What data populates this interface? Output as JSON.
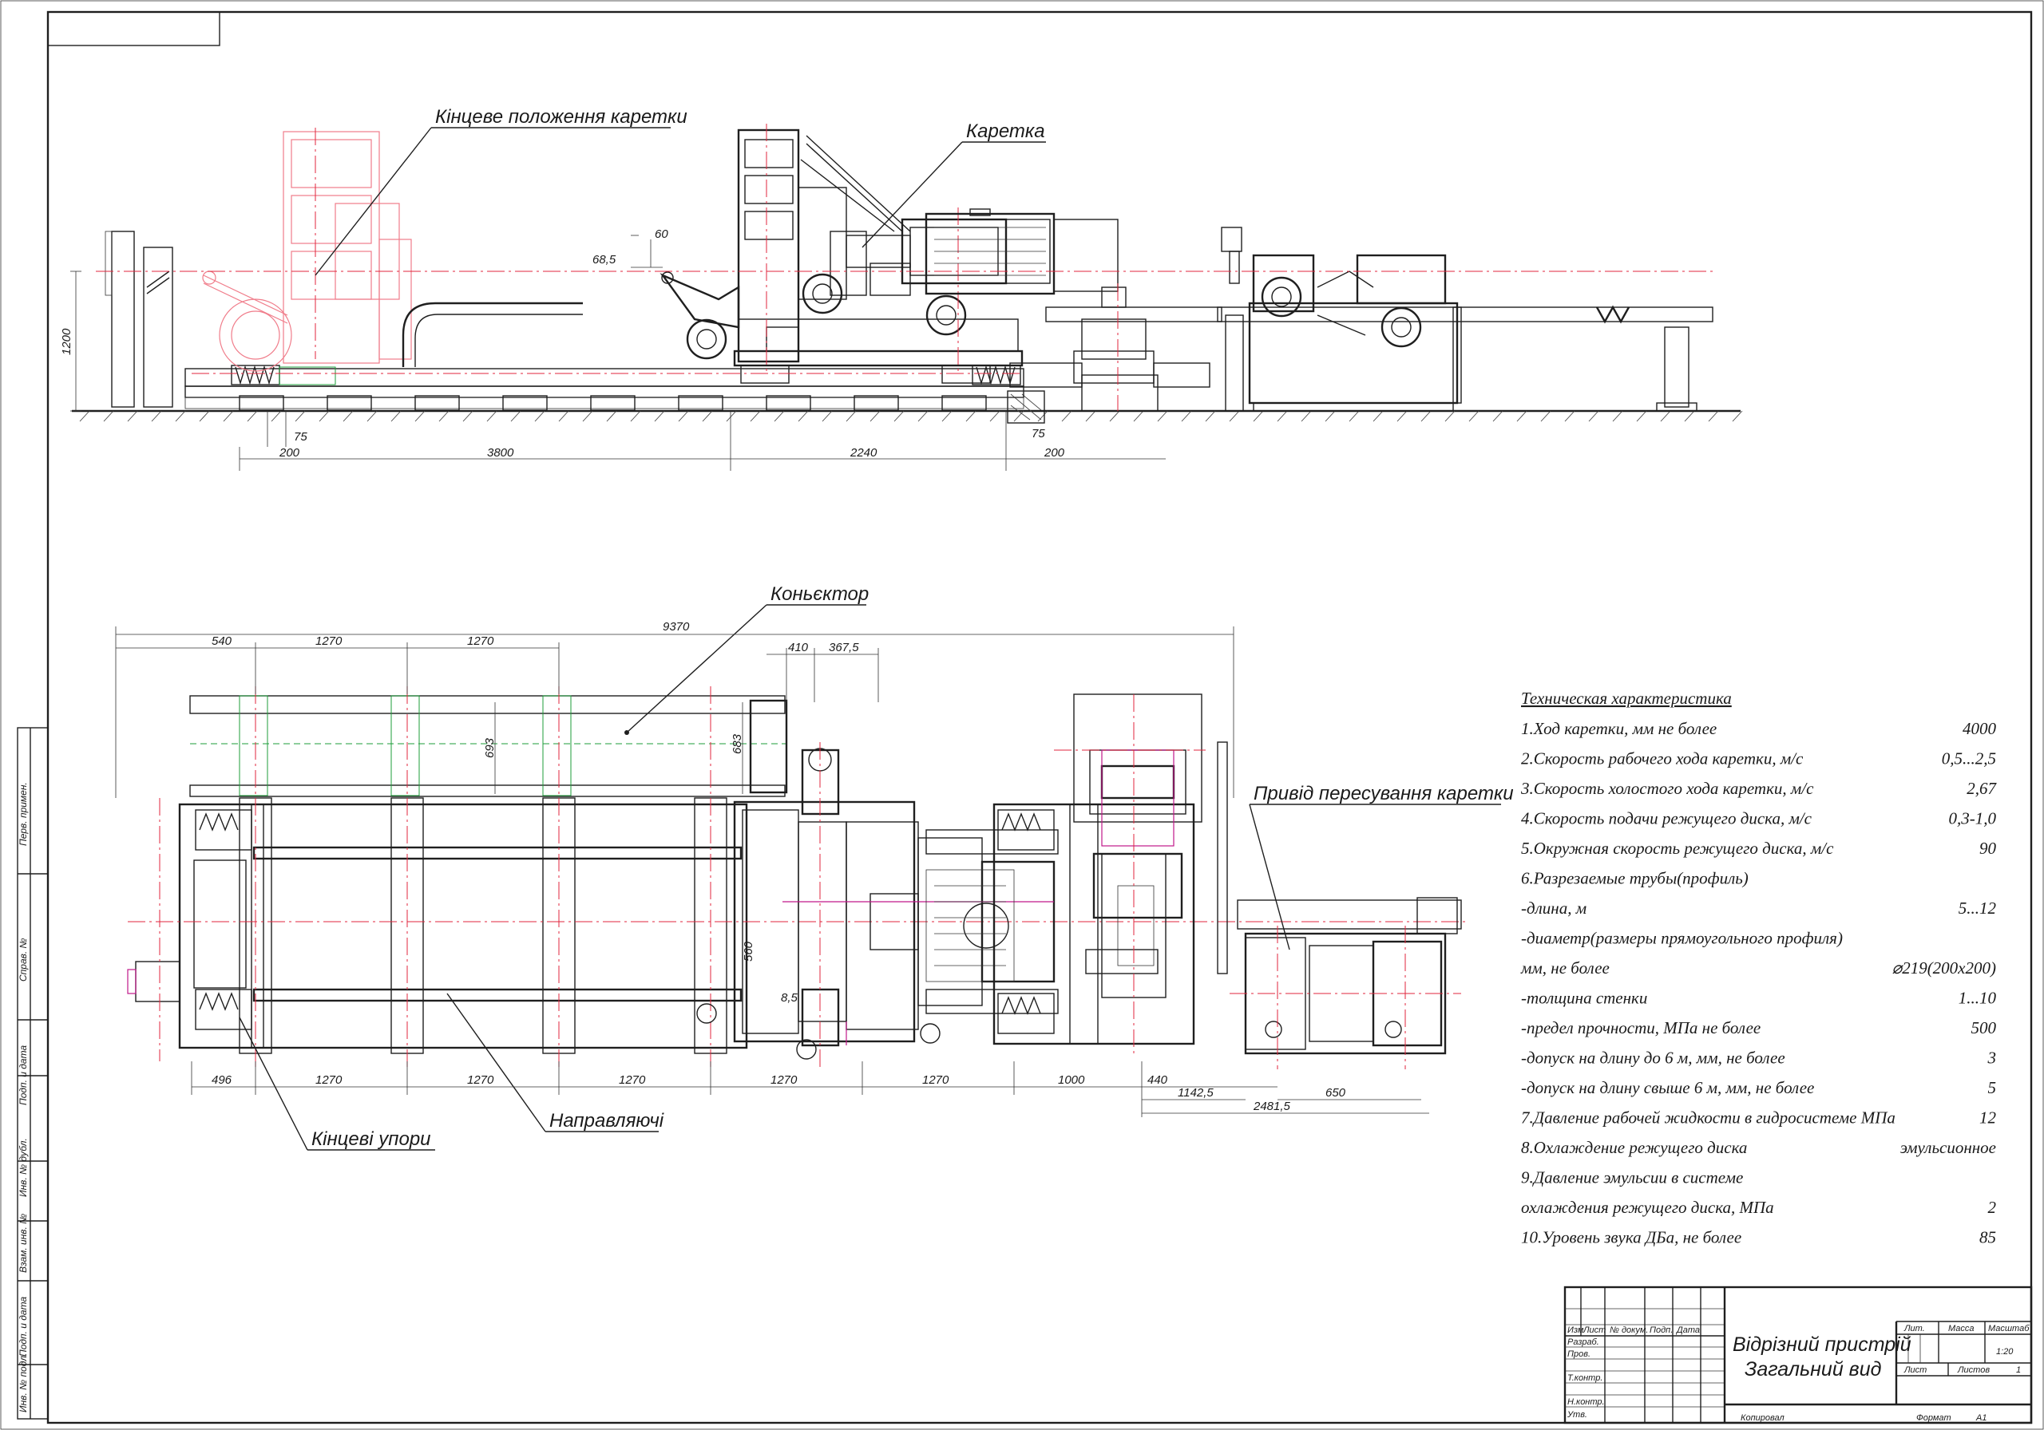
{
  "labels": {
    "end_position": "Кінцеве положення каретки",
    "carriage": "Каретка",
    "conveyor": "Коньєктор",
    "drive": "Привід пересування каретки",
    "end_stops": "Кінцеві упори",
    "guides": "Направляючі"
  },
  "dimensions_side": {
    "h1200": "1200",
    "d60": "60",
    "d685": "68,5",
    "d75a": "75",
    "d200a": "200",
    "d3800": "3800",
    "d2240": "2240",
    "d75b": "75",
    "d200b": "200"
  },
  "dimensions_plan": {
    "d9370": "9370",
    "d540": "540",
    "d1270a": "1270",
    "d1270b": "1270",
    "d410": "410",
    "d3675": "367,5",
    "d693": "693",
    "d683": "683",
    "d560": "560",
    "d85": "8,5",
    "d496": "496",
    "d1270c": "1270",
    "d1270d": "1270",
    "d1270e": "1270",
    "d1270f": "1270",
    "d1270g": "1270",
    "d1000": "1000",
    "d440": "440",
    "d11425": "1142,5",
    "d650": "650",
    "d24815": "2481,5"
  },
  "specs": {
    "title": "Техническая характеристика",
    "rows": [
      {
        "label": "1.Ход каретки, мм не более",
        "value": "4000"
      },
      {
        "label": "2.Скорость рабочего хода каретки, м/с",
        "value": "0,5...2,5"
      },
      {
        "label": "3.Скорость холостого хода каретки, м/с",
        "value": "2,67"
      },
      {
        "label": "4.Скорость подачи режущего диска, м/с",
        "value": "0,3-1,0"
      },
      {
        "label": "5.Окружная скорость режущего диска, м/с",
        "value": "90"
      },
      {
        "label": "6.Разрезаемые трубы(профиль)",
        "value": ""
      },
      {
        "label": "-длина, м",
        "value": "5...12"
      },
      {
        "label": "-диаметр(размеры прямоугольного профиля)",
        "value": ""
      },
      {
        "label": "мм, не более",
        "value": "⌀219(200x200)"
      },
      {
        "label": "-толщина стенки",
        "value": "1...10"
      },
      {
        "label": "-предел прочности, МПа не более",
        "value": "500"
      },
      {
        "label": "-допуск на длину до 6 м, мм, не более",
        "value": "3"
      },
      {
        "label": "-допуск на длину свыше 6 м, мм, не более",
        "value": "5"
      },
      {
        "label": "7.Давление рабочей жидкости в гидросистеме МПа",
        "value": "12"
      },
      {
        "label": "8.Охлаждение режущего диска",
        "value": "эмульсионное"
      },
      {
        "label": "9.Давление эмульсии в системе",
        "value": ""
      },
      {
        "label": "охлаждения режущего диска, МПа",
        "value": "2"
      },
      {
        "label": "10.Уровень звука ДБа, не более",
        "value": "85"
      }
    ]
  },
  "title_block": {
    "name_line1": "Відрізний пристрій",
    "name_line2": "Загальний вид",
    "col_izm": "Изм",
    "col_list": "Лист",
    "col_doc": "№ докум.",
    "col_sign": "Подп.",
    "col_date": "Дата",
    "row_razrab": "Разраб.",
    "row_prov": "Пров.",
    "row_tkontr": "Т.контр.",
    "row_nkontr": "Н.контр.",
    "row_utv": "Утв.",
    "lit": "Лит.",
    "mass": "Масса",
    "scale": "Масштаб",
    "scale_value": "1:20",
    "sheet": "Лист",
    "sheets": "Листов",
    "sheets_value": "1",
    "copied": "Копировал",
    "format_label": "Формат",
    "format_value": "A1"
  },
  "side_stamp": {
    "perv_primen": "Перв. примен.",
    "sprav_no": "Справ. №",
    "podp_data1": "Подп. и дата",
    "inv_dubl": "Инв. № дубл.",
    "vzam_inv": "Взам. инв. №",
    "podp_data2": "Подп. и дата",
    "inv_podl": "Инв. № подл."
  },
  "colors": {
    "line": "#1f1f1f",
    "axis": "#e0263c",
    "phantom": "#f07c8a",
    "hidden": "#1c9c3a",
    "accent": "#c0188a"
  }
}
